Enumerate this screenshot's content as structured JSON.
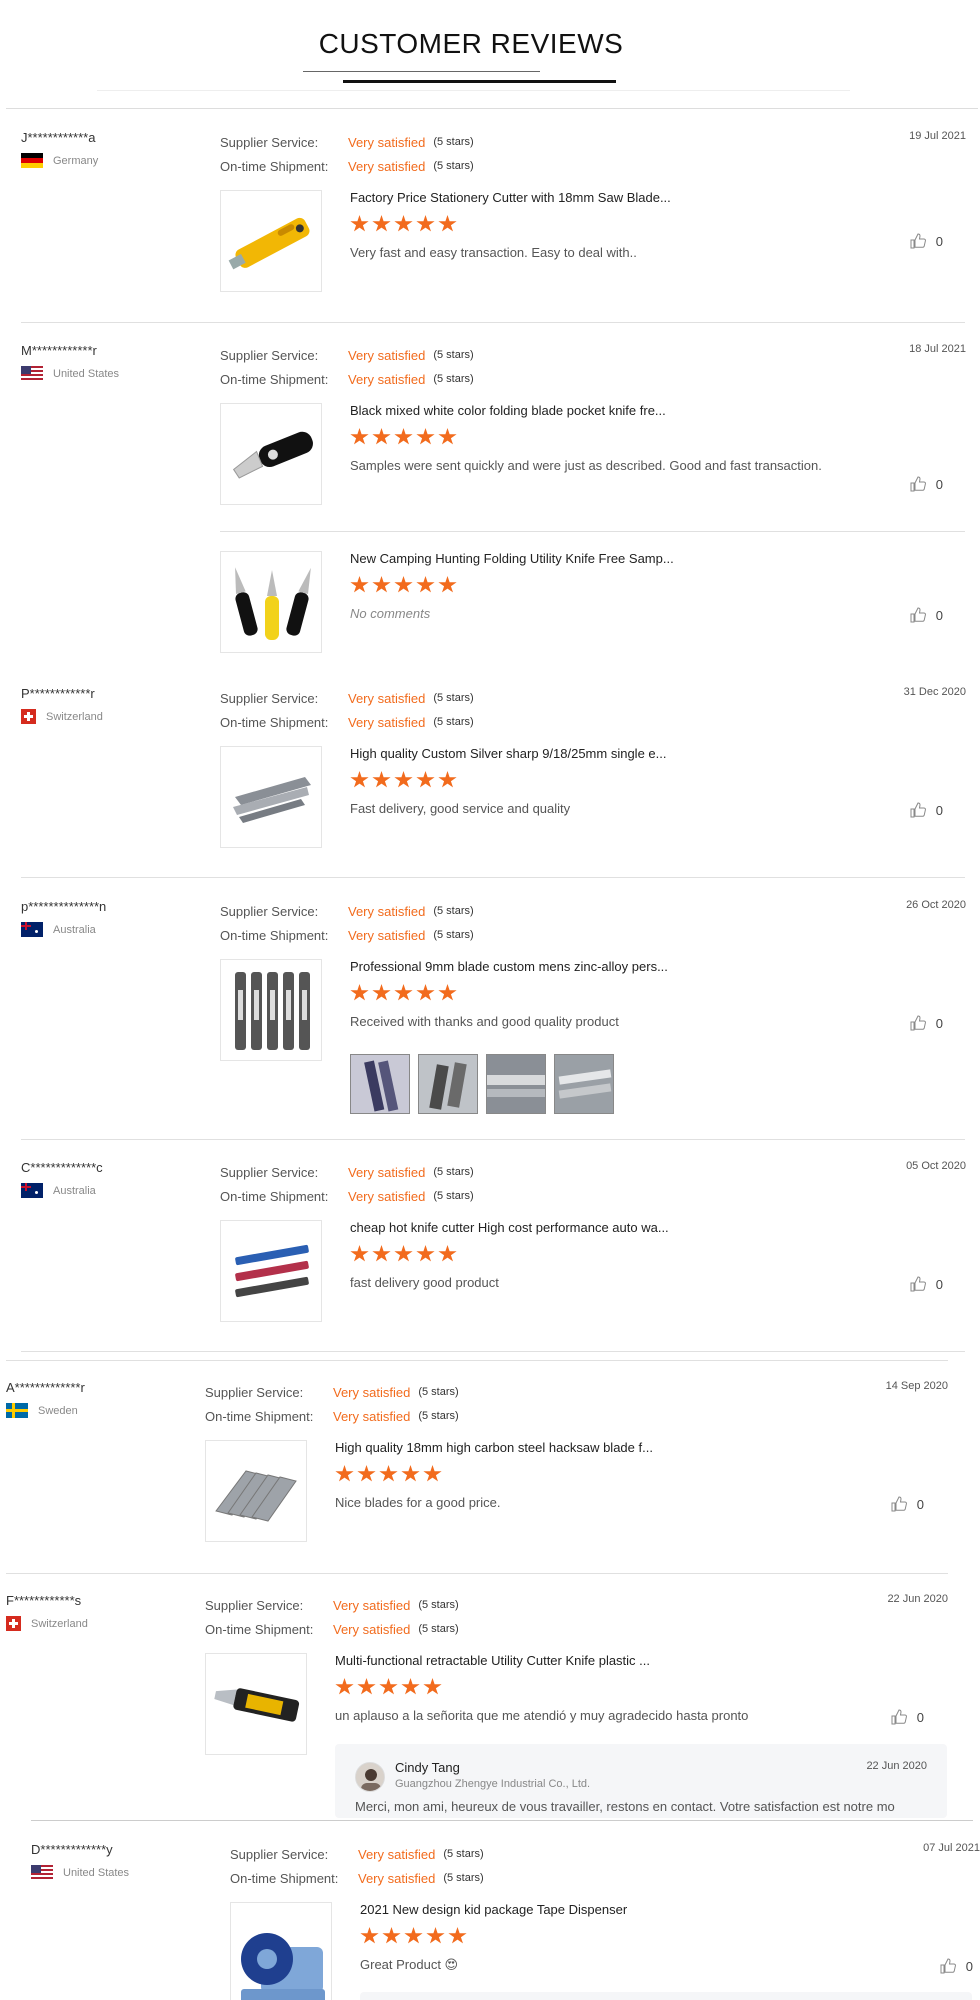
{
  "header": {
    "title": "CUSTOMER REVIEWS"
  },
  "labels": {
    "supplier_service": "Supplier Service:",
    "ontime_shipment": "On-time Shipment:",
    "very_satisfied": "Very satisfied",
    "five_stars": "(5 stars)",
    "no_comments": "No comments"
  },
  "colors": {
    "accent": "#f26b1d",
    "divider": "#e0e0e0"
  },
  "reviews": [
    {
      "buyer": "J************a",
      "country": "Germany",
      "flag": "flag-germany",
      "date": "19 Jul 2021",
      "products": [
        {
          "title": "Factory Price Stationery Cutter with 18mm Saw Blade...",
          "rating": 5,
          "comment": "Very fast and easy transaction. Easy to deal with..",
          "likes": "0",
          "image": "yellow-cutter-image"
        }
      ]
    },
    {
      "buyer": "M************r",
      "country": "United States",
      "flag": "flag-us",
      "date": "18 Jul 2021",
      "products": [
        {
          "title": "Black mixed white color folding blade pocket knife fre...",
          "rating": 5,
          "comment": "Samples were sent quickly and were just as described.  Good and fast transaction.",
          "likes": "0",
          "image": "folding-knife-image"
        },
        {
          "title": "New Camping Hunting Folding Utility Knife Free Samp...",
          "rating": 5,
          "comment": "No comments",
          "likes": "0",
          "image": "three-knives-image"
        }
      ]
    },
    {
      "buyer": "P************r",
      "country": "Switzerland",
      "flag": "flag-switzerland",
      "date": "31 Dec 2020",
      "products": [
        {
          "title": "High quality Custom Silver sharp 9/18/25mm single e...",
          "rating": 5,
          "comment": "Fast delivery, good service and quality",
          "likes": "0",
          "image": "silver-blades-image"
        }
      ]
    },
    {
      "buyer": "p**************n",
      "country": "Australia",
      "flag": "flag-australia",
      "date": "26 Oct 2020",
      "products": [
        {
          "title": "Professional 9mm blade custom mens zinc-alloy pers...",
          "rating": 5,
          "comment": "Received with thanks and good quality product",
          "likes": "0",
          "image": "five-cutters-image"
        }
      ]
    },
    {
      "buyer": "C*************c",
      "country": "Australia",
      "flag": "flag-australia",
      "date": "05 Oct 2020",
      "products": [
        {
          "title": "cheap hot knife cutter High cost performance auto wa...",
          "rating": 5,
          "comment": "fast delivery good product",
          "likes": "0",
          "image": "colored-cutters-image"
        }
      ]
    },
    {
      "buyer": "A*************r",
      "country": "Sweden",
      "flag": "flag-sweden",
      "date": "14 Sep 2020",
      "products": [
        {
          "title": "High quality 18mm high carbon steel hacksaw blade f...",
          "rating": 5,
          "comment": "Nice blades for a good price.",
          "likes": "0",
          "image": "hacksaw-blades-image"
        }
      ]
    },
    {
      "buyer": "F************s",
      "country": "Switzerland",
      "flag": "flag-switzerland",
      "date": "22 Jun 2020",
      "products": [
        {
          "title": "Multi-functional retractable Utility Cutter Knife plastic ...",
          "rating": 5,
          "comment": "un aplauso a la señorita que me atendió y muy agradecido hasta pronto",
          "likes": "0",
          "image": "retractable-cutter-image"
        }
      ],
      "reply": {
        "name": "Cindy Tang",
        "company": "Guangzhou Zhengye Industrial Co., Ltd.",
        "date": "22 Jun 2020",
        "text": "Merci, mon ami, heureux de vous travailler, restons en contact. Votre satisfaction est notre mo"
      }
    },
    {
      "buyer": "D*************y",
      "country": "United States",
      "flag": "flag-us",
      "date": "07 Jul 2021",
      "products": [
        {
          "title": "2021 New design kid package Tape Dispenser",
          "rating": 5,
          "comment": "Great Product 😍",
          "likes": "0",
          "image": "tape-dispenser-image"
        }
      ]
    }
  ]
}
